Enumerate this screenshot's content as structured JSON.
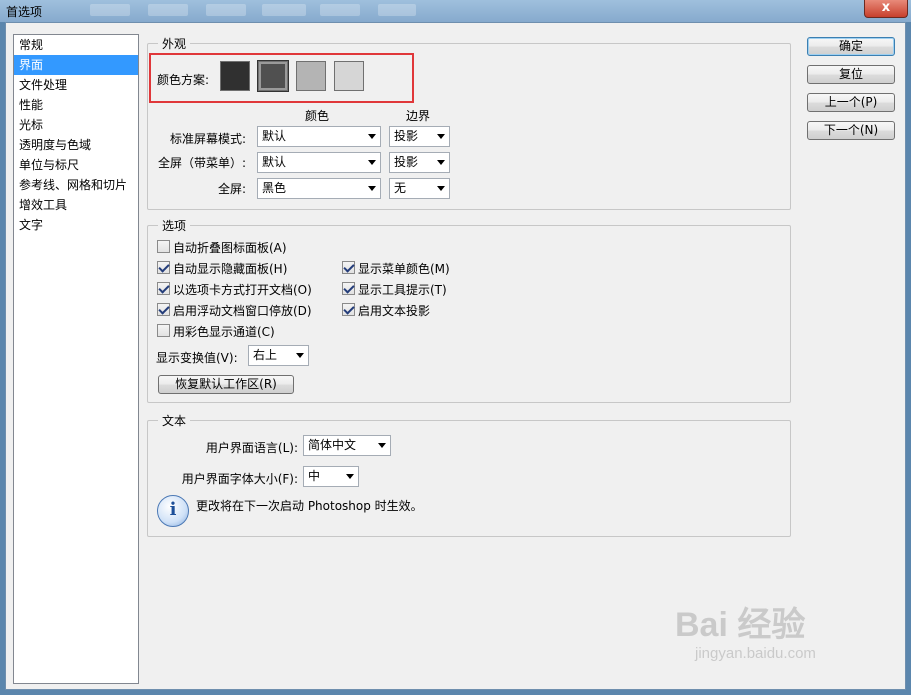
{
  "window": {
    "title": "首选项",
    "close": "x"
  },
  "sidebar": {
    "items": [
      {
        "label": "常规",
        "selected": false
      },
      {
        "label": "界面",
        "selected": true
      },
      {
        "label": "文件处理",
        "selected": false
      },
      {
        "label": "性能",
        "selected": false
      },
      {
        "label": "光标",
        "selected": false
      },
      {
        "label": "透明度与色域",
        "selected": false
      },
      {
        "label": "单位与标尺",
        "selected": false
      },
      {
        "label": "参考线、网格和切片",
        "selected": false
      },
      {
        "label": "增效工具",
        "selected": false
      },
      {
        "label": "文字",
        "selected": false
      }
    ]
  },
  "appearance": {
    "legend": "外观",
    "color_scheme_label": "颜色方案:",
    "swatch_colors": [
      "#303030",
      "#505050",
      "#b4b4b4",
      "#d6d6d6"
    ],
    "selected_swatch": 1,
    "col_color": "颜色",
    "col_border": "边界",
    "rows": [
      {
        "label": "标准屏幕模式:",
        "color": "默认",
        "border": "投影"
      },
      {
        "label": "全屏（带菜单）:",
        "color": "默认",
        "border": "投影"
      },
      {
        "label": "全屏:",
        "color": "黑色",
        "border": "无"
      }
    ]
  },
  "options": {
    "legend": "选项",
    "checkboxes": [
      {
        "label": "自动折叠图标面板(A)",
        "checked": false
      },
      {
        "label": "自动显示隐藏面板(H)",
        "checked": true
      },
      {
        "label": "显示菜单颜色(M)",
        "checked": true
      },
      {
        "label": "以选项卡方式打开文档(O)",
        "checked": true
      },
      {
        "label": "显示工具提示(T)",
        "checked": true
      },
      {
        "label": "启用浮动文档窗口停放(D)",
        "checked": true
      },
      {
        "label": "启用文本投影",
        "checked": true
      },
      {
        "label": "用彩色显示通道(C)",
        "checked": false
      }
    ],
    "transform_label": "显示变换值(V):",
    "transform_value": "右上",
    "reset_button": "恢复默认工作区(R)"
  },
  "text_group": {
    "legend": "文本",
    "ui_language_label": "用户界面语言(L):",
    "ui_language_value": "简体中文",
    "ui_font_size_label": "用户界面字体大小(F):",
    "ui_font_size_value": "中",
    "info_message": "更改将在下一次启动 Photoshop 时生效。"
  },
  "buttons": {
    "ok": "确定",
    "reset": "复位",
    "prev": "上一个(P)",
    "next": "下一个(N)"
  },
  "watermark": {
    "main": "Bai 经验",
    "sub": "jingyan.baidu.com"
  }
}
